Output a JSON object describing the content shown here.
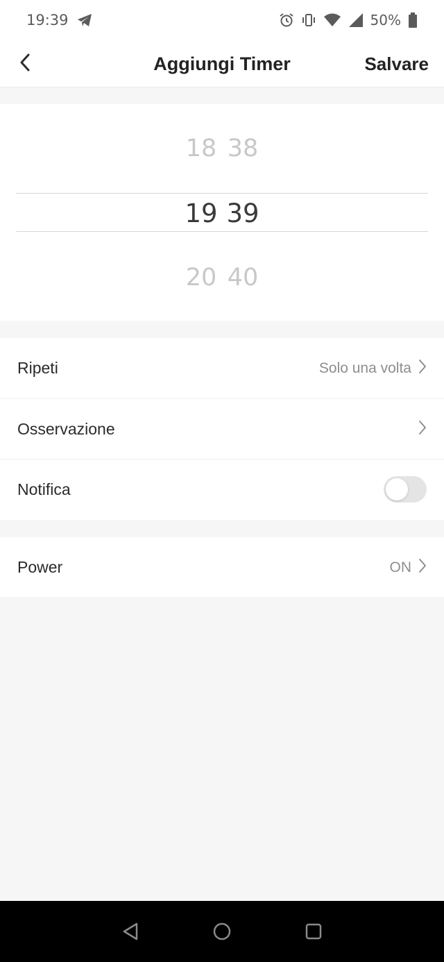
{
  "status_bar": {
    "time": "19:39",
    "battery": "50%",
    "icons": [
      "telegram-icon",
      "alarm-icon",
      "vibrate-icon",
      "wifi-icon",
      "signal-icon",
      "battery-icon"
    ]
  },
  "header": {
    "title": "Aggiungi Timer",
    "save_label": "Salvare",
    "back_icon": "chevron-left-icon"
  },
  "picker": {
    "prev": {
      "hour": "18",
      "minute": "38"
    },
    "current": {
      "hour": "19",
      "minute": "39"
    },
    "next": {
      "hour": "20",
      "minute": "40"
    }
  },
  "settings": {
    "repeat": {
      "label": "Ripeti",
      "value": "Solo una volta"
    },
    "note": {
      "label": "Osservazione",
      "value": ""
    },
    "notification": {
      "label": "Notifica",
      "enabled": false
    },
    "power": {
      "label": "Power",
      "value": "ON"
    }
  },
  "colors": {
    "accent_text": "#222222",
    "secondary_text": "#8e8e8e",
    "toggle_off": "#e4e4e4",
    "background": "#f6f6f6"
  },
  "nav_bar": {
    "icons": [
      "back-triangle-icon",
      "home-circle-icon",
      "recents-square-icon"
    ]
  }
}
